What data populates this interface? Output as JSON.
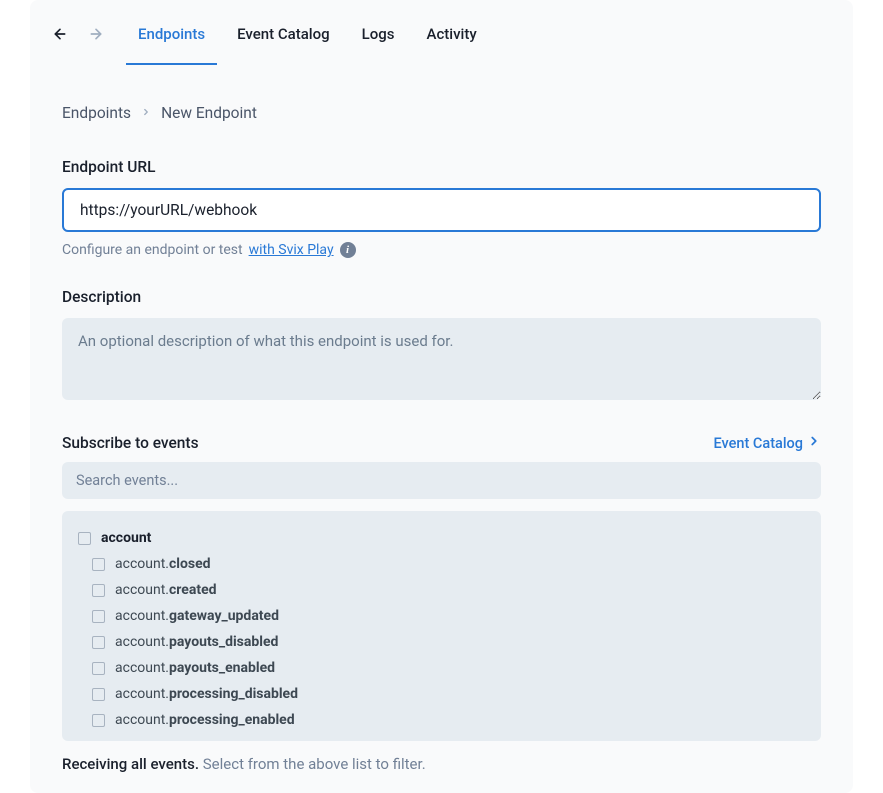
{
  "nav": {
    "tabs": [
      "Endpoints",
      "Event Catalog",
      "Logs",
      "Activity"
    ],
    "active": 0
  },
  "breadcrumb": {
    "parent": "Endpoints",
    "current": "New Endpoint"
  },
  "endpoint_url": {
    "label": "Endpoint URL",
    "value": "https://yourURL/webhook",
    "hint_prefix": "Configure an endpoint or test ",
    "hint_link": "with Svix Play"
  },
  "description": {
    "label": "Description",
    "placeholder": "An optional description of what this endpoint is used for."
  },
  "subscribe": {
    "label": "Subscribe to events",
    "catalog_link": "Event Catalog",
    "search_placeholder": "Search events...",
    "group": "account",
    "events": [
      {
        "prefix": "account.",
        "suffix": "closed"
      },
      {
        "prefix": "account.",
        "suffix": "created"
      },
      {
        "prefix": "account.",
        "suffix": "gateway_updated"
      },
      {
        "prefix": "account.",
        "suffix": "payouts_disabled"
      },
      {
        "prefix": "account.",
        "suffix": "payouts_enabled"
      },
      {
        "prefix": "account.",
        "suffix": "processing_disabled"
      },
      {
        "prefix": "account.",
        "suffix": "processing_enabled"
      }
    ]
  },
  "footer": {
    "bold": "Receiving all events.",
    "muted": " Select from the above list to filter."
  }
}
